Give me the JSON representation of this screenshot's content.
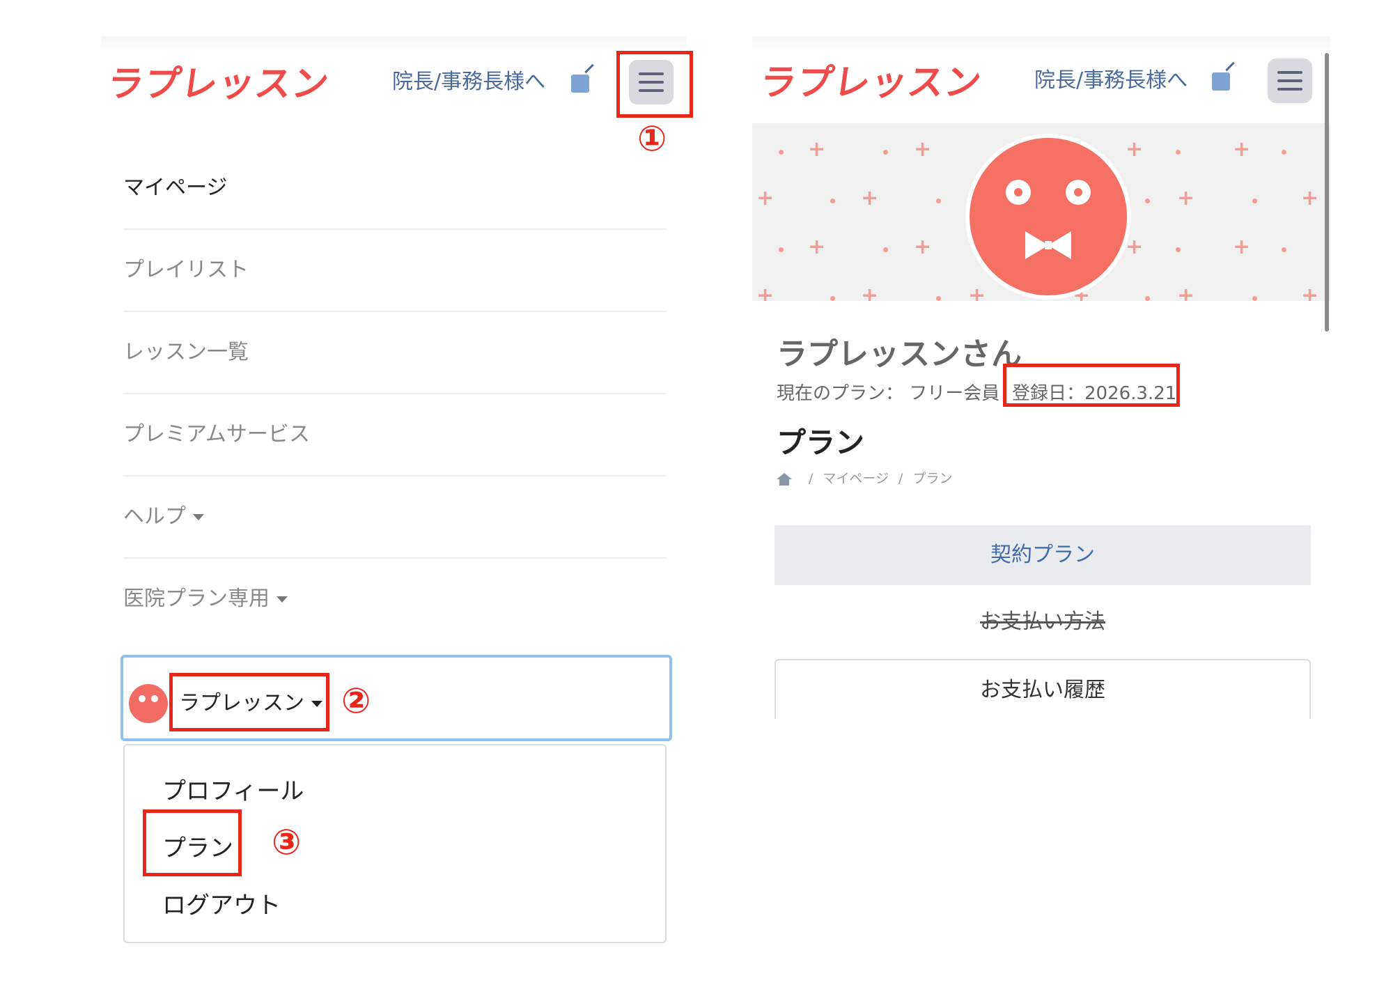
{
  "app": {
    "logo_text": "ラプレッスン",
    "director_link": "院長/事務長様へ"
  },
  "annotations": {
    "step1": "①",
    "step2": "②",
    "step3": "③",
    "highlight_color": "#e8261c"
  },
  "left_menu": {
    "items": [
      {
        "label": "マイページ"
      },
      {
        "label": "プレイリスト"
      },
      {
        "label": "レッスン一覧"
      },
      {
        "label": "プレミアムサービス"
      },
      {
        "label": "ヘルプ"
      },
      {
        "label": "医院プラン専用"
      }
    ],
    "user_name": "ラプレッスン",
    "dropdown": [
      {
        "label": "プロフィール"
      },
      {
        "label": "プラン"
      },
      {
        "label": "ログアウト"
      }
    ]
  },
  "profile": {
    "name": "ラプレッスンさん",
    "plan_label": "現在のプラン： フリー会員",
    "registered": "登録日：2026.3.21",
    "page_title": "プラン",
    "breadcrumb": [
      "マイページ",
      "プラン"
    ],
    "tabs": [
      {
        "label": "契約プラン"
      },
      {
        "label": "お支払い方法"
      },
      {
        "label": "お支払い履歴"
      }
    ]
  },
  "colors": {
    "brand": "#f04b4b",
    "avatar": "#f46f64",
    "link": "#4a6a9c"
  }
}
